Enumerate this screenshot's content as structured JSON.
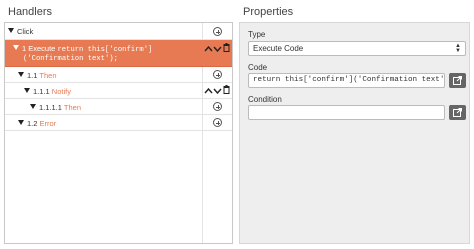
{
  "handlers": {
    "title": "Handlers",
    "rows": [
      {
        "prefix": "Click",
        "name": ""
      },
      {
        "prefix": "1 Execute",
        "code1": "return this['confirm']",
        "code2": "('Confirmation text');"
      },
      {
        "prefix": "1.1",
        "name": "Then"
      },
      {
        "prefix": "1.1.1",
        "name": "Notify"
      },
      {
        "prefix": "1.1.1.1",
        "name": "Then"
      },
      {
        "prefix": "1.2",
        "name": "Error"
      }
    ]
  },
  "properties": {
    "title": "Properties",
    "type_label": "Type",
    "type_value": "Execute Code",
    "code_label": "Code",
    "code_value": "return this['confirm']('Confirmation text')",
    "condition_label": "Condition",
    "condition_value": ""
  },
  "colors": {
    "accent": "#e77a52",
    "panel_bg": "#eeeeee"
  }
}
